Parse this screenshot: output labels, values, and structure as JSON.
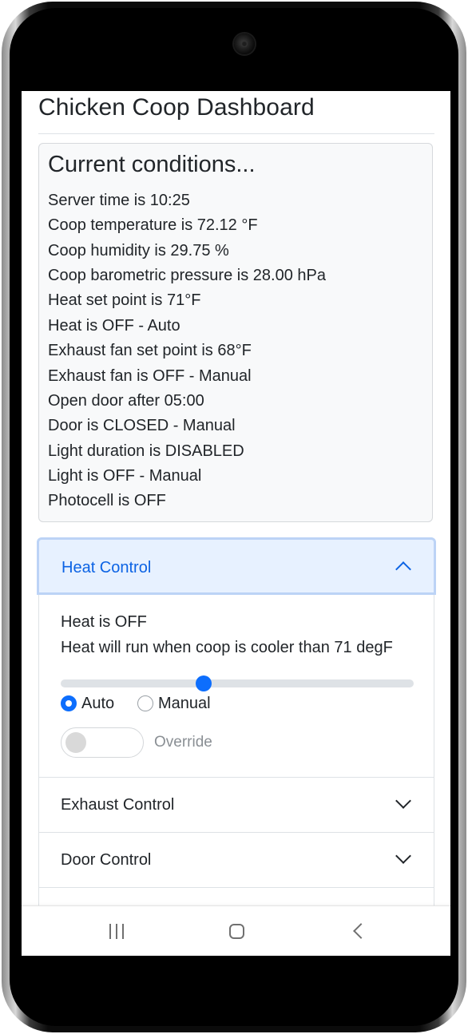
{
  "page": {
    "title": "Chicken Coop Dashboard"
  },
  "conditions": {
    "heading": "Current conditions...",
    "lines": [
      "Server time is 10:25",
      "Coop temperature is 72.12 °F",
      "Coop humidity is 29.75 %",
      "Coop barometric pressure is 28.00 hPa",
      "Heat set point is 71°F",
      "Heat is OFF - Auto",
      "Exhaust fan set point is 68°F",
      "Exhaust fan is OFF - Manual",
      "Open door after 05:00",
      "Door is CLOSED - Manual",
      "Light duration is DISABLED",
      "Light is OFF - Manual",
      "Photocell is OFF"
    ]
  },
  "heat_control": {
    "title": "Heat Control",
    "status": "Heat is OFF",
    "description": "Heat will run when coop is cooler than 71 degF",
    "slider_value_fraction": 0.405,
    "mode_auto_label": "Auto",
    "mode_manual_label": "Manual",
    "mode_selected": "Auto",
    "override_label": "Override",
    "override_on": false
  },
  "exhaust_control": {
    "title": "Exhaust Control"
  },
  "door_control": {
    "title": "Door Control"
  },
  "colors": {
    "accent": "#0d6efd",
    "active_header_bg": "#e7f1ff",
    "active_header_text": "#0c63e4",
    "card_bg": "#f8f9fa",
    "text": "#212529"
  },
  "icons": {
    "heat_chevron": "chevron-up-icon",
    "exhaust_chevron": "chevron-down-icon",
    "door_chevron": "chevron-down-icon",
    "nav_recent": "recent-apps-icon",
    "nav_home": "home-icon",
    "nav_back": "back-icon"
  }
}
